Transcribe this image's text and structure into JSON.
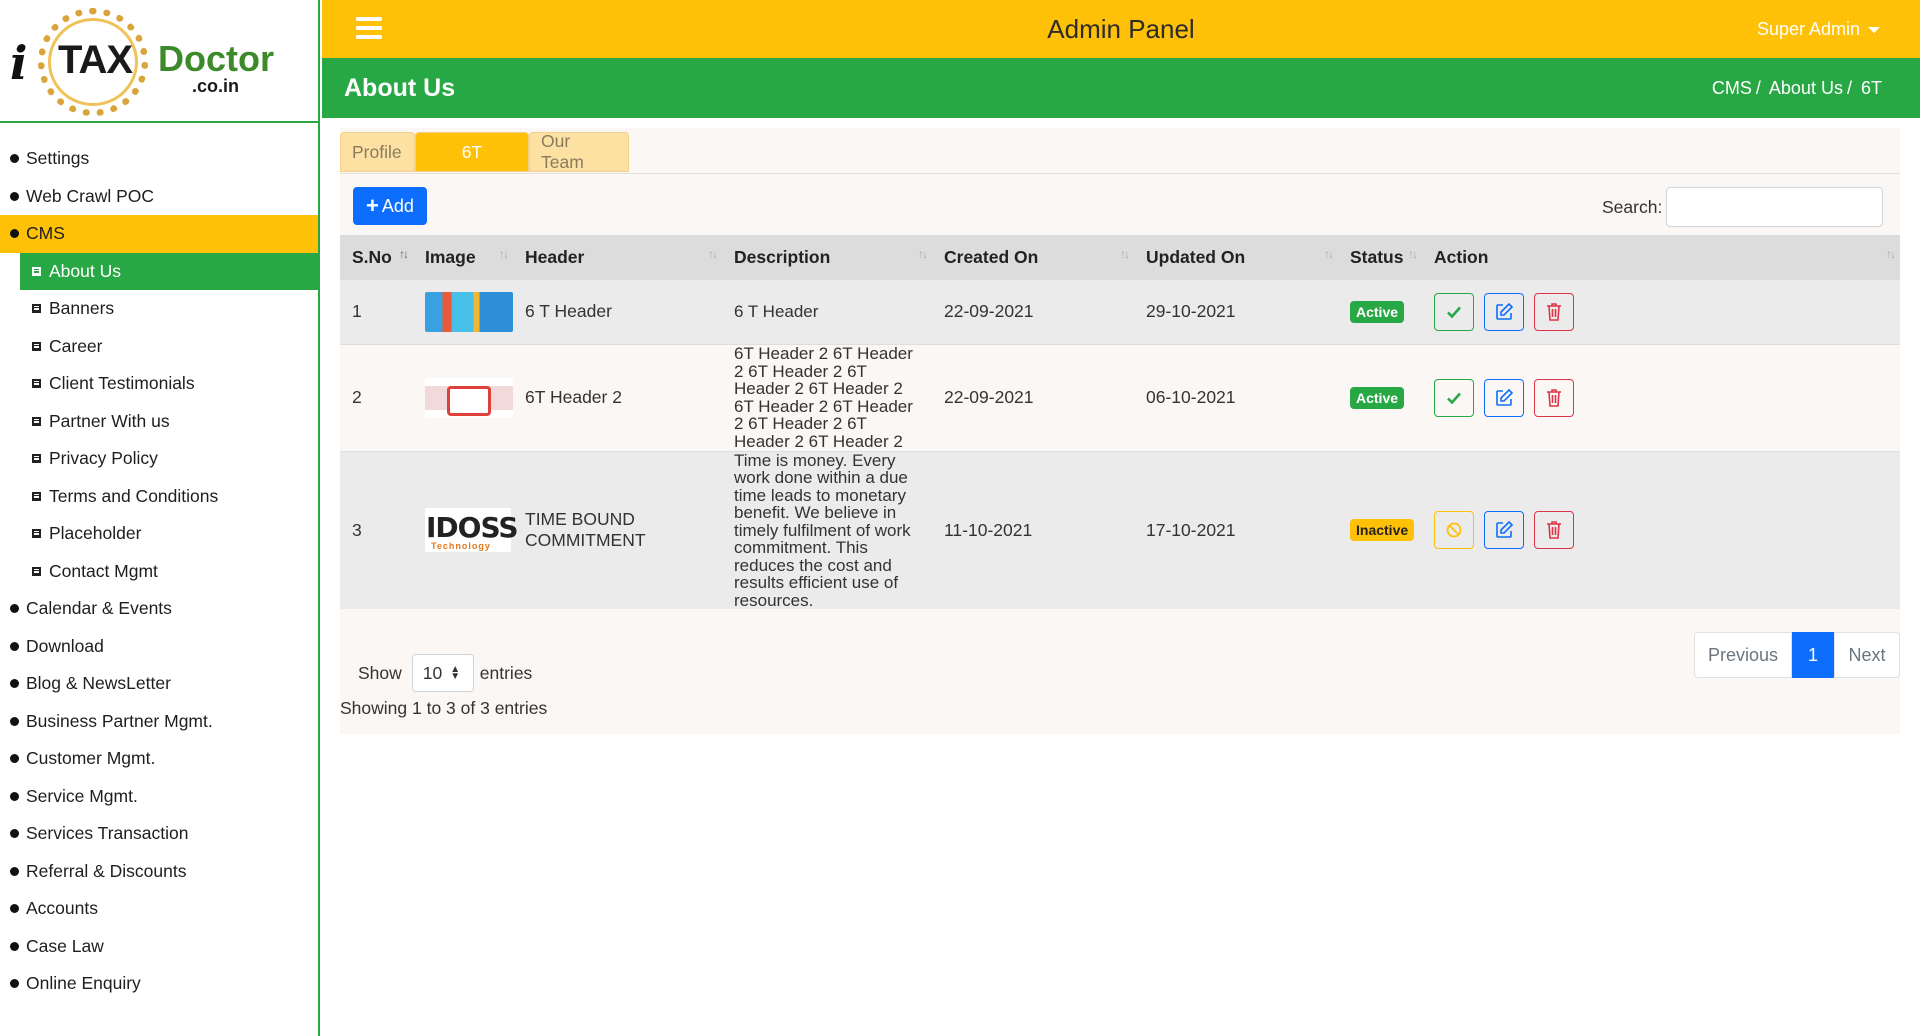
{
  "logo": {
    "i": "i",
    "tax": "TAX",
    "doctor": "Doctor",
    "domain": ".co.in"
  },
  "topbar": {
    "title": "Admin Panel",
    "user": "Super Admin"
  },
  "page": {
    "title": "About Us",
    "breadcrumb": [
      "CMS",
      "About Us",
      "6T"
    ]
  },
  "sidebar": {
    "items": [
      {
        "label": "Settings"
      },
      {
        "label": "Web Crawl POC"
      },
      {
        "label": "CMS"
      },
      {
        "label": "About Us"
      },
      {
        "label": "Banners"
      },
      {
        "label": "Career"
      },
      {
        "label": "Client Testimonials"
      },
      {
        "label": "Partner With us"
      },
      {
        "label": "Privacy Policy"
      },
      {
        "label": "Terms and Conditions"
      },
      {
        "label": "Placeholder"
      },
      {
        "label": "Contact Mgmt"
      },
      {
        "label": "Calendar & Events"
      },
      {
        "label": "Download"
      },
      {
        "label": "Blog & NewsLetter"
      },
      {
        "label": "Business Partner Mgmt."
      },
      {
        "label": "Customer Mgmt."
      },
      {
        "label": "Service Mgmt."
      },
      {
        "label": "Services Transaction"
      },
      {
        "label": "Referral & Discounts"
      },
      {
        "label": "Accounts"
      },
      {
        "label": "Case Law"
      },
      {
        "label": "Online Enquiry"
      }
    ]
  },
  "tabs": [
    "Profile",
    "6T",
    "Our Team"
  ],
  "toolbar": {
    "add_label": "Add",
    "search_label": "Search:",
    "search_value": ""
  },
  "table": {
    "headers": [
      "S.No",
      "Image",
      "Header",
      "Description",
      "Created On",
      "Updated On",
      "Status",
      "Action"
    ],
    "rows": [
      {
        "sno": "1",
        "header": "6 T Header",
        "description": "6 T Header",
        "created": "22-09-2021",
        "updated": "29-10-2021",
        "status": "Active"
      },
      {
        "sno": "2",
        "header": "6T Header 2",
        "description": "6T Header 2 6T Header 2 6T Header 2 6T Header 2 6T Header 2 6T Header 2 6T Header 2 6T Header 2 6T Header 2 6T Header 2",
        "created": "22-09-2021",
        "updated": "06-10-2021",
        "status": "Active"
      },
      {
        "sno": "3",
        "header": "TIME BOUND COMMITMENT",
        "description": "Time is money. Every work done within a due time leads to monetary benefit. We believe in timely fulfilment of work commitment. This reduces the cost and results efficient use of resources.",
        "created": "11-10-2021",
        "updated": "17-10-2021",
        "status": "Inactive"
      }
    ],
    "row3_image_text": "IDOSS",
    "row3_image_sub": "Technology"
  },
  "length": {
    "show": "Show",
    "value": "10",
    "entries": "entries"
  },
  "info": "Showing 1 to 3 of 3 entries",
  "pagination": {
    "prev": "Previous",
    "page": "1",
    "next": "Next"
  },
  "colors": {
    "yellow": "#ffc107",
    "green": "#28a745",
    "blue": "#0d6efd",
    "red": "#dc3545"
  }
}
